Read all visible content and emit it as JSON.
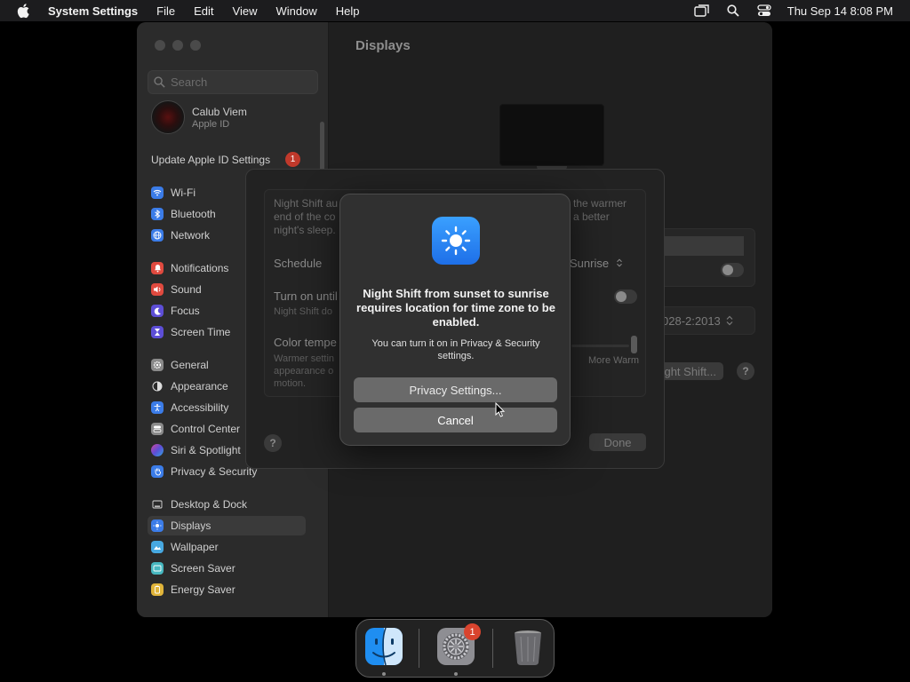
{
  "menubar": {
    "app_name": "System Settings",
    "menus": [
      "File",
      "Edit",
      "View",
      "Window",
      "Help"
    ],
    "clock": "Thu Sep 14  8:08 PM"
  },
  "sidebar": {
    "search_placeholder": "Search",
    "profile": {
      "name": "Calub Viem",
      "subtitle": "Apple ID"
    },
    "update": {
      "label": "Update Apple ID Settings",
      "badge": "1"
    },
    "items": [
      {
        "label": "Wi-Fi",
        "icon": "wifi-icon",
        "color": "#3b7ce8"
      },
      {
        "label": "Bluetooth",
        "icon": "bluetooth-icon",
        "color": "#3b7ce8"
      },
      {
        "label": "Network",
        "icon": "globe-icon",
        "color": "#3b7ce8"
      },
      {
        "label": "Notifications",
        "icon": "bell-icon",
        "color": "#e04a3f"
      },
      {
        "label": "Sound",
        "icon": "speaker-icon",
        "color": "#e04a3f"
      },
      {
        "label": "Focus",
        "icon": "moon-icon",
        "color": "#5d4ed6"
      },
      {
        "label": "Screen Time",
        "icon": "hourglass-icon",
        "color": "#5d4ed6"
      },
      {
        "label": "General",
        "icon": "gear-icon",
        "color": "#8a8a8a"
      },
      {
        "label": "Appearance",
        "icon": "appearance-icon",
        "color": "#2a2a2a"
      },
      {
        "label": "Accessibility",
        "icon": "accessibility-icon",
        "color": "#3b7ce8"
      },
      {
        "label": "Control Center",
        "icon": "control-center-icon",
        "color": "#8a8a8a"
      },
      {
        "label": "Siri & Spotlight",
        "icon": "siri-icon",
        "color": "#7a4ed6"
      },
      {
        "label": "Privacy & Security",
        "icon": "hand-icon",
        "color": "#3b7ce8"
      },
      {
        "label": "Desktop & Dock",
        "icon": "dock-icon",
        "color": "#2a2a2a"
      },
      {
        "label": "Displays",
        "icon": "sun-icon",
        "color": "#3b7ce8"
      },
      {
        "label": "Wallpaper",
        "icon": "wallpaper-icon",
        "color": "#47a8e0"
      },
      {
        "label": "Screen Saver",
        "icon": "screensaver-icon",
        "color": "#47b8c0"
      },
      {
        "label": "Energy Saver",
        "icon": "battery-icon",
        "color": "#e0b43a"
      }
    ],
    "selected": "Displays"
  },
  "content": {
    "title": "Displays",
    "date_value": "028-2:2013",
    "night_shift_button": "ight Shift...",
    "help": "?"
  },
  "sheet": {
    "desc_left": [
      "Night Shift au",
      "end of the co",
      "night's sleep."
    ],
    "desc_right": [
      "the warmer",
      "a better"
    ],
    "schedule_label": "Schedule",
    "schedule_value": "Sunrise",
    "turn_on_label": "Turn on until",
    "turn_on_sub": "Night Shift do",
    "color_temp_label": "Color tempe",
    "color_temp_sub": [
      "Warmer settin",
      "appearance o",
      "motion."
    ],
    "more_warm": "More Warm",
    "done": "Done",
    "help": "?"
  },
  "alert": {
    "title": "Night Shift from sunset to sunrise requires location for time zone to be enabled.",
    "message": "You can turn it on in Privacy & Security settings.",
    "primary_button": "Privacy Settings...",
    "cancel_button": "Cancel"
  },
  "dock": {
    "apps": [
      {
        "name": "Finder",
        "icon": "finder-icon"
      },
      {
        "name": "System Settings",
        "icon": "system-settings-icon",
        "badge": "1"
      },
      {
        "name": "Trash",
        "icon": "trash-icon"
      }
    ]
  }
}
